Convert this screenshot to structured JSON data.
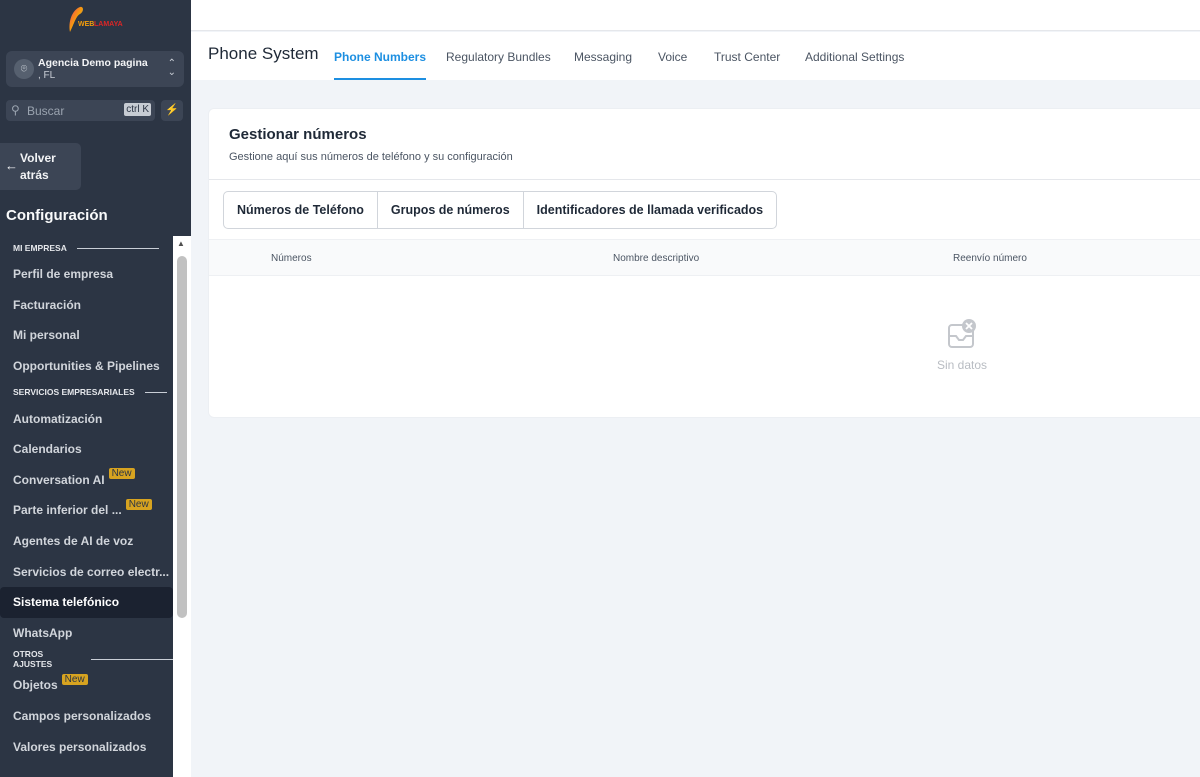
{
  "sidebar": {
    "logo_text": "WEBLAMAYA",
    "account": {
      "name": "Agencia Demo pagina",
      "location": ", FL"
    },
    "search": {
      "placeholder": "Buscar",
      "shortcut": "ctrl K"
    },
    "back_label": "Volver atrás",
    "section_title": "Configuración",
    "groups": [
      {
        "label": "MI EMPRESA",
        "items": [
          {
            "label": "Perfil de empresa"
          },
          {
            "label": "Facturación"
          },
          {
            "label": "Mi personal"
          },
          {
            "label": "Opportunities & Pipelines"
          }
        ]
      },
      {
        "label": "SERVICIOS EMPRESARIALES",
        "items": [
          {
            "label": "Automatización"
          },
          {
            "label": "Calendarios"
          },
          {
            "label": "Conversation AI",
            "badge": "New"
          },
          {
            "label": "Parte inferior del ...",
            "badge": "New"
          },
          {
            "label": "Agentes de AI de voz"
          },
          {
            "label": "Servicios de correo electr..."
          },
          {
            "label": "Sistema telefónico",
            "active": true
          },
          {
            "label": "WhatsApp"
          }
        ]
      },
      {
        "label": "OTROS AJUSTES",
        "items": [
          {
            "label": "Objetos",
            "badge": "New"
          },
          {
            "label": "Campos personalizados"
          },
          {
            "label": "Valores personalizados"
          }
        ]
      }
    ]
  },
  "header": {
    "title": "Phone System",
    "tabs": [
      {
        "label": "Phone Numbers",
        "active": true
      },
      {
        "label": "Regulatory Bundles"
      },
      {
        "label": "Messaging"
      },
      {
        "label": "Voice"
      },
      {
        "label": "Trust Center"
      },
      {
        "label": "Additional Settings"
      }
    ]
  },
  "card": {
    "title": "Gestionar números",
    "subtitle": "Gestione aquí sus números de teléfono y su configuración",
    "segments": [
      "Números de Teléfono",
      "Grupos de números",
      "Identificadores de llamada verificados"
    ],
    "columns": [
      "Números",
      "Nombre descriptivo",
      "Reenvío número"
    ],
    "empty_text": "Sin datos"
  },
  "colors": {
    "sidebar": "#2c3544",
    "accent": "#1d8fe1",
    "badge": "#d7a320"
  }
}
